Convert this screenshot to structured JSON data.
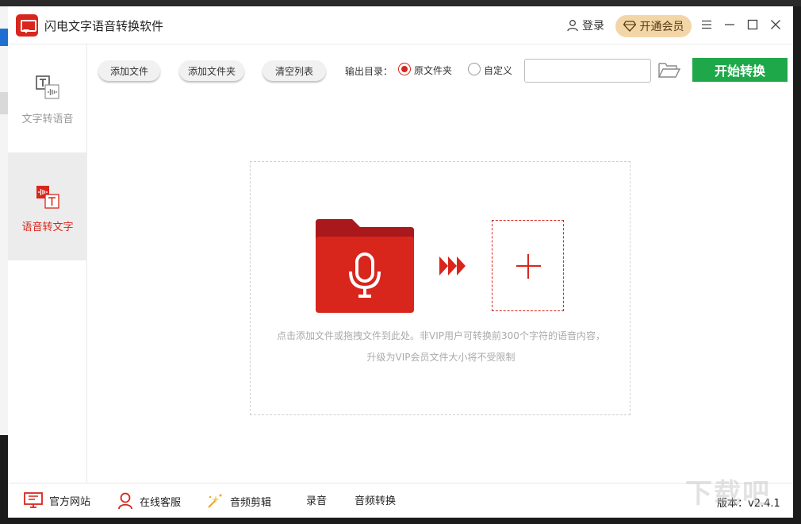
{
  "app": {
    "title": "闪电文字语音转换软件"
  },
  "header": {
    "login_label": "登录",
    "vip_label": "开通会员"
  },
  "sidebar": {
    "items": [
      {
        "label": "文字转语音",
        "active": false
      },
      {
        "label": "语音转文字",
        "active": true
      }
    ]
  },
  "toolbar": {
    "add_file": "添加文件",
    "add_folder": "添加文件夹",
    "clear_list": "清空列表",
    "output_label": "输出目录：",
    "option_original": "原文件夹",
    "option_custom": "自定义",
    "path_value": "",
    "start_label": "开始转换"
  },
  "dropzone": {
    "hint_line1": "点击添加文件或拖拽文件到此处。非VIP用户可转换前300个字符的语音内容，",
    "hint_line2": "升级为VIP会员文件大小将不受限制"
  },
  "footer": {
    "website": "官方网站",
    "support": "在线客服",
    "audio_edit": "音频剪辑",
    "record": "录音",
    "audio_convert": "音频转换",
    "version": "版本：v2.4.1",
    "watermark": "下载吧"
  },
  "colors": {
    "brand_red": "#d8261d",
    "start_green": "#1ea84a",
    "vip_gold": "#f3d6a8"
  }
}
